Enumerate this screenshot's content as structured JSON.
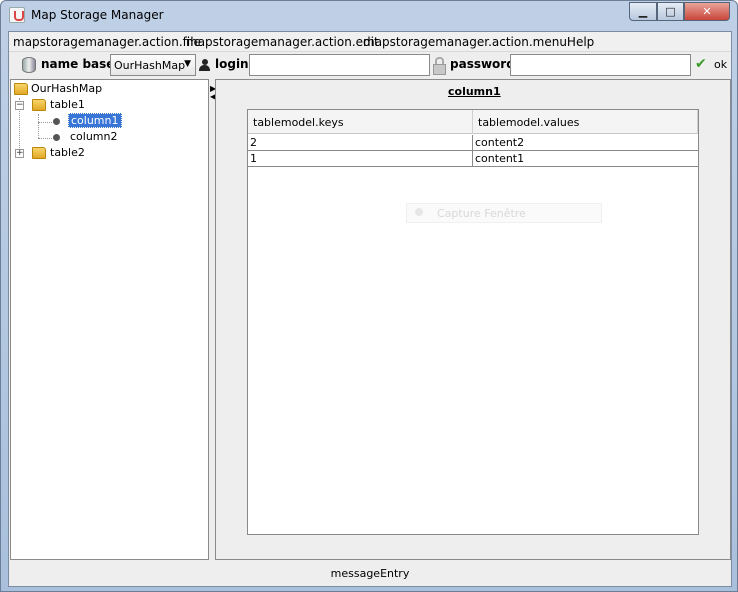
{
  "window": {
    "title": "Map Storage Manager",
    "minimize": "▁",
    "maximize": "□",
    "close": "✕"
  },
  "menu": {
    "file": "mapstoragemanager.action.file",
    "edit": "mapstoragemanager.action.edit",
    "help": "mapstoragemanager.action.menuHelp"
  },
  "toolbar": {
    "name_base_label": "name base :",
    "name_base_value": "OurHashMap",
    "login_label": "login :",
    "login_value": "",
    "password_label": "password :",
    "password_value": "",
    "ok_label": "ok",
    "icons": [
      "database-icon",
      "user-icon",
      "lock-icon",
      "checkmark-icon"
    ]
  },
  "tree": {
    "root": "OurHashMap",
    "table1": "table1",
    "column1": "column1",
    "column2": "column2",
    "table2": "table2",
    "expand_collapsed": "+",
    "expand_open": "−"
  },
  "detail": {
    "title": "column1",
    "columns": [
      "tablemodel.keys",
      "tablemodel.values"
    ],
    "rows": [
      [
        "2",
        "content2"
      ],
      [
        "1",
        "content1"
      ]
    ],
    "overlay_text": "Capture Fenêtre"
  },
  "status": {
    "message": "messageEntry"
  },
  "colors": {
    "selection": "#3875d7",
    "window_frame": "#bfd0e6",
    "close_button": "#c9463a"
  }
}
